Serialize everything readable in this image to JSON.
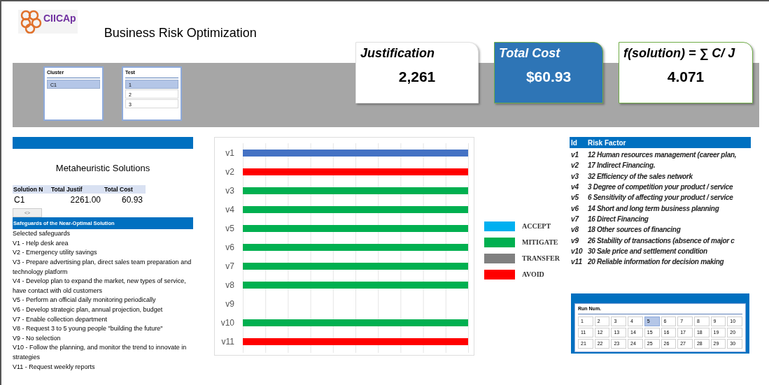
{
  "logo": {
    "text": "CIICAp"
  },
  "title": "Business Risk Optimization",
  "cluster_list": {
    "header": "Cluster",
    "items": [
      {
        "label": "C1",
        "selected": true
      }
    ]
  },
  "test_list": {
    "header": "Test",
    "items": [
      {
        "label": "1",
        "selected": true
      },
      {
        "label": "2",
        "selected": false
      },
      {
        "label": "3",
        "selected": false
      }
    ]
  },
  "kpis": [
    {
      "label": "Justification",
      "value": "2,261",
      "kind": "plain"
    },
    {
      "label": "Total Cost",
      "value": "$60.93",
      "kind": "highlight"
    },
    {
      "label": "f(solution) = ∑ C/ J",
      "value": "4.071",
      "kind": "outlined"
    }
  ],
  "solutions": {
    "title": "Metaheuristic Solutions",
    "columns": [
      "Solution N",
      "Total Justif",
      "Total Cost"
    ],
    "rows": [
      [
        "C1",
        "2261.00",
        "60.93"
      ]
    ],
    "button": "<>"
  },
  "safeguards": {
    "header": "Safeguards of the Near-Optimal Solution",
    "lines": [
      "Selected safeguards",
      "V1 - Help desk area",
      "V2 - Emergency utility savings",
      "V3 - Prepare advertising plan, direct sales team preparation and technology platform",
      "V4 - Develop plan to expand the market, new types of service, have contact with old customers",
      "V5 - Perform an official daily monitoring periodically",
      "V6 - Develop strategic plan, annual projection, budget",
      "V7 - Enable collection department",
      "V8 - Request 3 to 5 young people \"building the future\"",
      "V9 - No selection",
      "V10 - Follow the planning, and monitor the trend to innovate in strategies",
      "V11 - Request weekly reports"
    ]
  },
  "risk_bars": [
    {
      "label": "v1",
      "color": "#4472c4"
    },
    {
      "label": "v2",
      "color": "#ff0000"
    },
    {
      "label": "v3",
      "color": "#00b050"
    },
    {
      "label": "v4",
      "color": "#00b050"
    },
    {
      "label": "v5",
      "color": "#00b050"
    },
    {
      "label": "v6",
      "color": "#00b050"
    },
    {
      "label": "v7",
      "color": "#00b050"
    },
    {
      "label": "v8",
      "color": "#00b050"
    },
    {
      "label": "v9"
    },
    {
      "label": "v10",
      "color": "#00b050"
    },
    {
      "label": "v11",
      "color": "#ff0000"
    }
  ],
  "legend": [
    {
      "label": "ACCEPT",
      "color": "#00b0f0"
    },
    {
      "label": "MITIGATE",
      "color": "#00b050"
    },
    {
      "label": "TRANSFER",
      "color": "#808080"
    },
    {
      "label": "AVOID",
      "color": "#ff0000"
    }
  ],
  "risk_table": {
    "columns": [
      "Id",
      "Risk Factor"
    ],
    "rows": [
      {
        "id": "v1",
        "factor": "12 Human resources management (career plan,"
      },
      {
        "id": "v2",
        "factor": "17 Indirect Financing."
      },
      {
        "id": "v3",
        "factor": "32 Efficiency of the sales network"
      },
      {
        "id": "v4",
        "factor": "3 Degree of competition your product / service"
      },
      {
        "id": "v5",
        "factor": "6 Sensitivity of affecting your product / service"
      },
      {
        "id": "v6",
        "factor": "14 Short and long term business planning"
      },
      {
        "id": "v7",
        "factor": "16 Direct Financing"
      },
      {
        "id": "v8",
        "factor": "18 Other sources of financing"
      },
      {
        "id": "v9",
        "factor": "26 Stability of transactions (absence of major c"
      },
      {
        "id": "v10",
        "factor": "30 Sale price and settlement condition"
      },
      {
        "id": "v11",
        "factor": "20 Reliable information for decision making"
      }
    ]
  },
  "run_picker": {
    "label": "Run Num.",
    "cells": [
      {
        "label": "1",
        "selected": false
      },
      {
        "label": "2",
        "selected": false
      },
      {
        "label": "3",
        "selected": false
      },
      {
        "label": "4",
        "selected": false
      },
      {
        "label": "5",
        "selected": true
      },
      {
        "label": "6",
        "selected": false
      },
      {
        "label": "7",
        "selected": false
      },
      {
        "label": "8",
        "selected": false
      },
      {
        "label": "9",
        "selected": false
      },
      {
        "label": "10",
        "selected": false
      },
      {
        "label": "11",
        "selected": false
      },
      {
        "label": "12",
        "selected": false
      },
      {
        "label": "13",
        "selected": false
      },
      {
        "label": "14",
        "selected": false
      },
      {
        "label": "15",
        "selected": false
      },
      {
        "label": "16",
        "selected": false
      },
      {
        "label": "17",
        "selected": false
      },
      {
        "label": "18",
        "selected": false
      },
      {
        "label": "19",
        "selected": false
      },
      {
        "label": "20",
        "selected": false
      },
      {
        "label": "21",
        "selected": false
      },
      {
        "label": "22",
        "selected": false
      },
      {
        "label": "23",
        "selected": false
      },
      {
        "label": "24",
        "selected": false
      },
      {
        "label": "25",
        "selected": false
      },
      {
        "label": "26",
        "selected": false
      },
      {
        "label": "27",
        "selected": false
      },
      {
        "label": "28",
        "selected": false
      },
      {
        "label": "29",
        "selected": false
      },
      {
        "label": "30",
        "selected": false
      }
    ]
  }
}
